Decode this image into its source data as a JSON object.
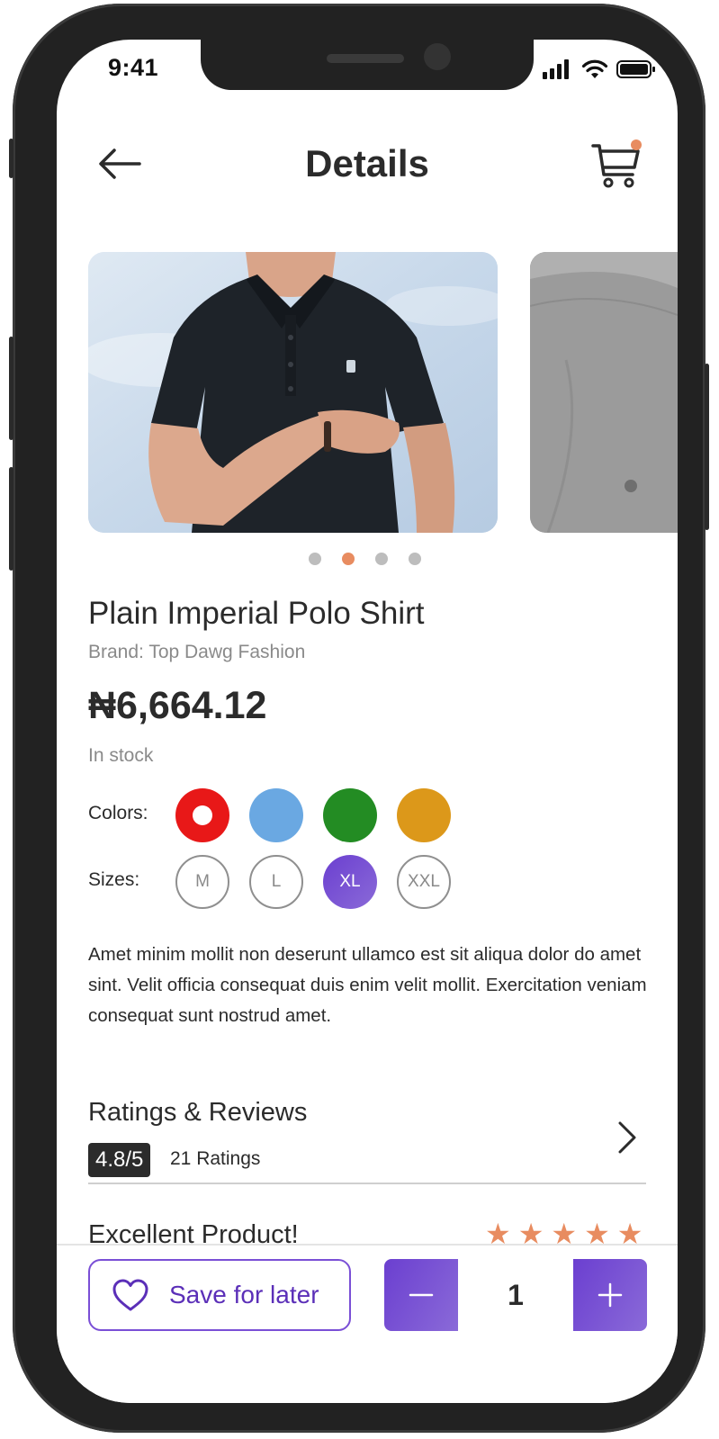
{
  "status_bar": {
    "time": "9:41",
    "icons": [
      "cellular-signal-icon",
      "wifi-icon",
      "battery-icon"
    ]
  },
  "header": {
    "title": "Details",
    "back_icon": "arrow-left-icon",
    "cart_icon": "shopping-cart-icon",
    "cart_badge_color": "#e88c60"
  },
  "carousel": {
    "slide_count": 4,
    "active_index": 1,
    "active_color": "#e88c60",
    "inactive_color": "#bdbdbd"
  },
  "product": {
    "name": "Plain Imperial Polo Shirt",
    "brand": "Brand: Top Dawg Fashion",
    "price": "₦6,664.12",
    "stock_status": "In stock",
    "colors_label": "Colors:",
    "colors": [
      {
        "hex": "#e81818",
        "selected": true
      },
      {
        "hex": "#6aa8e2",
        "selected": false
      },
      {
        "hex": "#238c23",
        "selected": false
      },
      {
        "hex": "#dc981a",
        "selected": false
      }
    ],
    "sizes_label": "Sizes:",
    "sizes": [
      {
        "label": "M",
        "selected": false
      },
      {
        "label": "L",
        "selected": false
      },
      {
        "label": "XL",
        "selected": true
      },
      {
        "label": "XXL",
        "selected": false
      }
    ],
    "description": "Amet minim mollit non deserunt ullamco est sit aliqua dolor do amet sint. Velit officia consequat duis enim velit mollit. Exercitation veniam consequat sunt nostrud amet."
  },
  "ratings": {
    "title": "Ratings & Reviews",
    "score": "4.8/5",
    "count": "21 Ratings",
    "chevron_icon": "chevron-right-icon"
  },
  "review": {
    "title": "Excellent Product!",
    "stars": 5,
    "star_color": "#e88c60"
  },
  "bottom_bar": {
    "save_label": "Save for later",
    "save_icon": "heart-icon",
    "quantity": "1",
    "minus_icon": "minus-icon",
    "plus_icon": "plus-icon",
    "accent": "#6b3fd0"
  }
}
